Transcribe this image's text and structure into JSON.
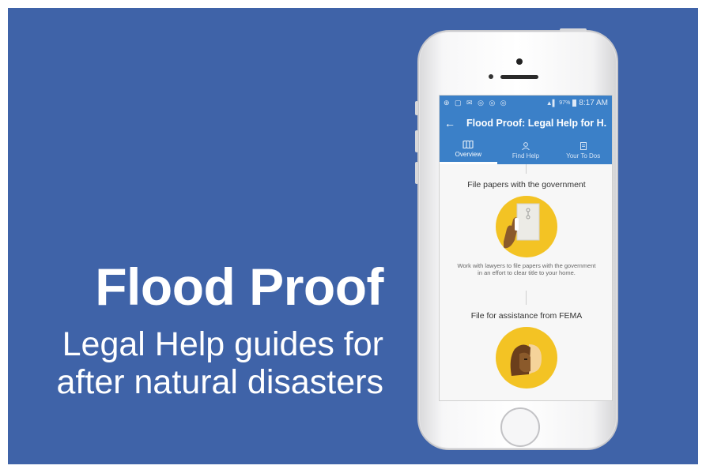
{
  "promo": {
    "headline": "Flood Proof",
    "tagline": "Legal Help guides for after natural disasters"
  },
  "phone": {
    "status_bar": {
      "left_icons": "⊕ ▢ ✉ ◎ ◎ ◎",
      "battery": "97%",
      "time": "8:17 AM"
    },
    "app_bar": {
      "back_icon": "←",
      "title": "Flood Proof: Legal Help for H..."
    },
    "tabs": [
      {
        "label": "Overview",
        "icon": "map-icon",
        "active": true
      },
      {
        "label": "Find Help",
        "icon": "person-icon",
        "active": false
      },
      {
        "label": "Your To Dos",
        "icon": "clipboard-icon",
        "active": false
      }
    ],
    "items": [
      {
        "title": "File papers with the government",
        "icon": "document-hand-icon",
        "description": "Work with lawyers to file papers with the government in an effort to clear title to your home."
      },
      {
        "title": "File for assistance from FEMA",
        "icon": "faces-icon",
        "description": ""
      }
    ]
  },
  "colors": {
    "background": "#3f63a8",
    "app_primary": "#3b80c8",
    "icon_circle": "#f3c324"
  }
}
